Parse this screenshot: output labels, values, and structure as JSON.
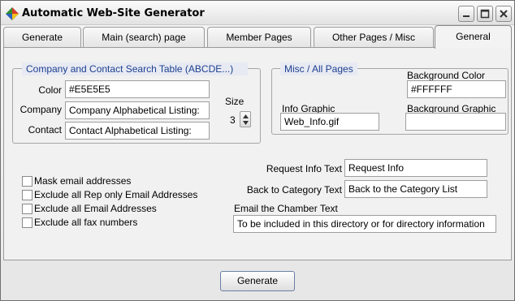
{
  "window": {
    "title": "Automatic Web-Site Generator"
  },
  "tabs": [
    {
      "label": "Generate"
    },
    {
      "label": "Main (search) page"
    },
    {
      "label": "Member Pages"
    },
    {
      "label": "Other Pages / Misc"
    },
    {
      "label": "General",
      "active": true
    }
  ],
  "company_group": {
    "title": "Company and Contact Search Table (ABCDE...)",
    "color_label": "Color",
    "color_value": "#E5E5E5",
    "company_label": "Company",
    "company_value": "Company Alphabetical Listing:",
    "contact_label": "Contact",
    "contact_value": "Contact Alphabetical Listing:",
    "size_label": "Size",
    "size_value": "3"
  },
  "misc_group": {
    "title": "Misc / All Pages",
    "background_color_label": "Background Color",
    "background_color_value": "#FFFFFF",
    "info_graphic_label": "Info Graphic",
    "info_graphic_value": "Web_Info.gif",
    "background_graphic_label": "Background Graphic",
    "background_graphic_value": ""
  },
  "checkboxes": [
    {
      "label": "Mask email addresses",
      "checked": false
    },
    {
      "label": "Exclude all Rep only Email Addresses",
      "checked": false
    },
    {
      "label": "Exclude all Email Addresses",
      "checked": false
    },
    {
      "label": "Exclude all fax numbers",
      "checked": false
    }
  ],
  "texts": {
    "request_info_label": "Request Info Text",
    "request_info_value": "Request Info",
    "back_to_category_label": "Back to Category Text",
    "back_to_category_value": "Back to the Category List",
    "email_chamber_label": "Email the Chamber Text",
    "email_chamber_value": "To be included in this directory or for directory information"
  },
  "footer": {
    "generate_label": "Generate"
  },
  "colors": {
    "group_title_text": "#1B3F8F",
    "group_title_bg": "#E8EAF3"
  },
  "icons": {
    "app": "diamond-app-icon",
    "minimize": "minimize-icon",
    "maximize": "maximize-icon",
    "close": "close-icon",
    "spin_up": "arrow-up-icon",
    "spin_down": "arrow-down-icon"
  }
}
